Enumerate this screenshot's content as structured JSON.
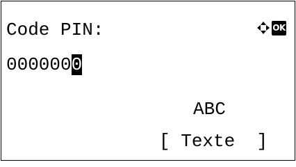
{
  "screen": {
    "title": "Code PIN:",
    "pin_value": "000000",
    "pin_cursor_char": "0",
    "input_mode": "ABC",
    "softkey": {
      "open_bracket": "[",
      "label": "Texte",
      "close_bracket": "]"
    },
    "icons": {
      "navigation": "dpad-arrows-icon",
      "confirm": "ok-icon",
      "confirm_label": "OK"
    }
  }
}
